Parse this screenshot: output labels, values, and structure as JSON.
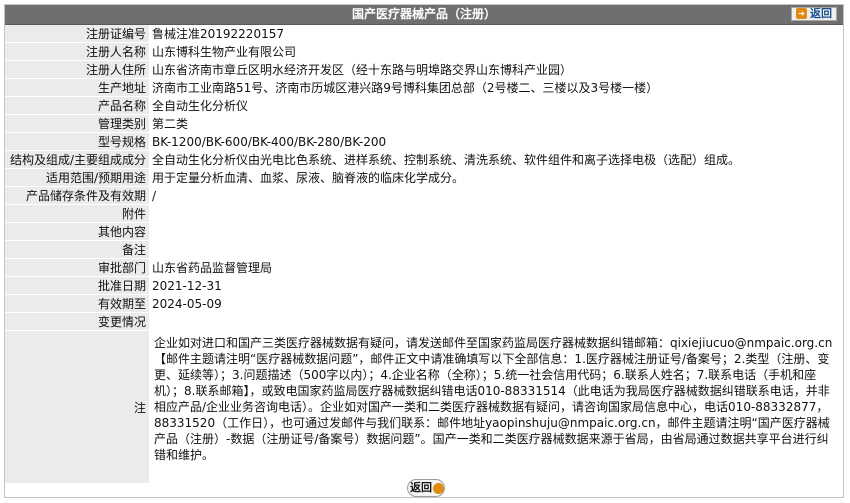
{
  "header": {
    "title": "国产医疗器械产品（注册）",
    "back_label": "返回"
  },
  "rows": [
    {
      "label": "注册证编号",
      "value": "鲁械注准20192220157"
    },
    {
      "label": "注册人名称",
      "value": "山东博科生物产业有限公司"
    },
    {
      "label": "注册人住所",
      "value": "山东省济南市章丘区明水经济开发区（经十东路与明埠路交界山东博科产业园）"
    },
    {
      "label": "生产地址",
      "value": "济南市工业南路51号、济南市历城区港兴路9号博科集团总部（2号楼二、三楼以及3号楼一楼）"
    },
    {
      "label": "产品名称",
      "value": "全自动生化分析仪"
    },
    {
      "label": "管理类别",
      "value": "第二类"
    },
    {
      "label": "型号规格",
      "value": "BK-1200/BK-600/BK-400/BK-280/BK-200"
    },
    {
      "label": "结构及组成/主要组成成分",
      "value": "全自动生化分析仪由光电比色系统、进样系统、控制系统、清洗系统、软件组件和离子选择电极（选配）组成。"
    },
    {
      "label": "适用范围/预期用途",
      "value": "用于定量分析血清、血浆、尿液、脑脊液的临床化学成分。"
    },
    {
      "label": "产品储存条件及有效期",
      "value": "/"
    },
    {
      "label": "附件",
      "value": ""
    },
    {
      "label": "其他内容",
      "value": ""
    },
    {
      "label": "备注",
      "value": ""
    },
    {
      "label": "审批部门",
      "value": "山东省药品监督管理局"
    },
    {
      "label": "批准日期",
      "value": "2021-12-31"
    },
    {
      "label": "有效期至",
      "value": "2024-05-09"
    }
  ],
  "change": {
    "label": "变更情况",
    "value": ""
  },
  "note": {
    "label": "注",
    "value": "企业如对进口和国产三类医疗器械数据有疑问，请发送邮件至国家药监局医疗器械数据纠错邮箱：qixiejiucuo@nmpaic.org.cn【邮件主题请注明“医疗器械数据问题”，邮件正文中请准确填写以下全部信息：1.医疗器械注册证号/备案号；2.类型（注册、变更、延续等）；3.问题描述（500字以内）；4.企业名称（全称）；5.统一社会信用代码；6.联系人姓名；7.联系电话（手机和座机）；8.联系邮箱】，或致电国家药监局医疗器械数据纠错电话010-88331514（此电话为我局医疗器械数据纠错联系电话，并非相应产品/企业业务咨询电话）。企业如对国产一类和二类医疗器械数据有疑问，请咨询国家局信息中心，电话010-88332877，88331520（工作日），也可通过发邮件与我们联系：邮件地址yaopinshuju@nmpaic.org.cn，邮件主题请注明“国产医疗器械产品（注册）-数据（注册证号/备案号）数据问题”。国产一类和二类医疗器械数据来源于省局，由省局通过数据共享平台进行纠错和维护。"
  },
  "footer": {
    "back_label": "返回"
  }
}
